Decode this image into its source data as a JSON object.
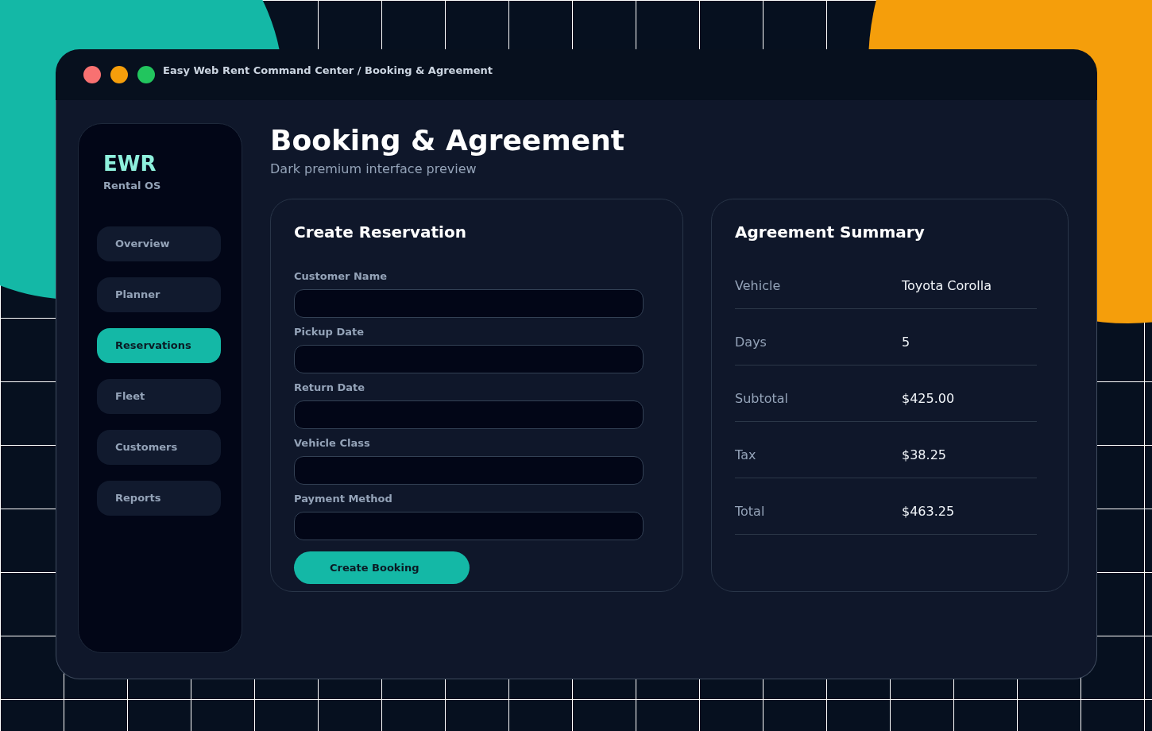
{
  "window": {
    "title": "Easy Web Rent Command Center / Booking & Agreement"
  },
  "sidebar": {
    "logo": "EWR",
    "tagline": "Rental OS",
    "items": [
      {
        "label": "Overview",
        "selected": false
      },
      {
        "label": "Planner",
        "selected": false
      },
      {
        "label": "Reservations",
        "selected": true
      },
      {
        "label": "Fleet",
        "selected": false
      },
      {
        "label": "Customers",
        "selected": false
      },
      {
        "label": "Reports",
        "selected": false
      }
    ]
  },
  "page": {
    "title": "Booking & Agreement",
    "subtitle": "Dark premium interface preview"
  },
  "reservation_form": {
    "title": "Create Reservation",
    "fields": [
      {
        "label": "Customer Name"
      },
      {
        "label": "Pickup Date"
      },
      {
        "label": "Return Date"
      },
      {
        "label": "Vehicle Class"
      },
      {
        "label": "Payment Method"
      }
    ],
    "submit": "Create Booking"
  },
  "agreement_summary": {
    "title": "Agreement Summary",
    "rows": [
      {
        "label": "Vehicle",
        "value": "Toyota Corolla"
      },
      {
        "label": "Days",
        "value": "5"
      },
      {
        "label": "Subtotal",
        "value": "$425.00"
      },
      {
        "label": "Tax",
        "value": "$38.25"
      },
      {
        "label": "Total",
        "value": "$463.25"
      }
    ]
  }
}
